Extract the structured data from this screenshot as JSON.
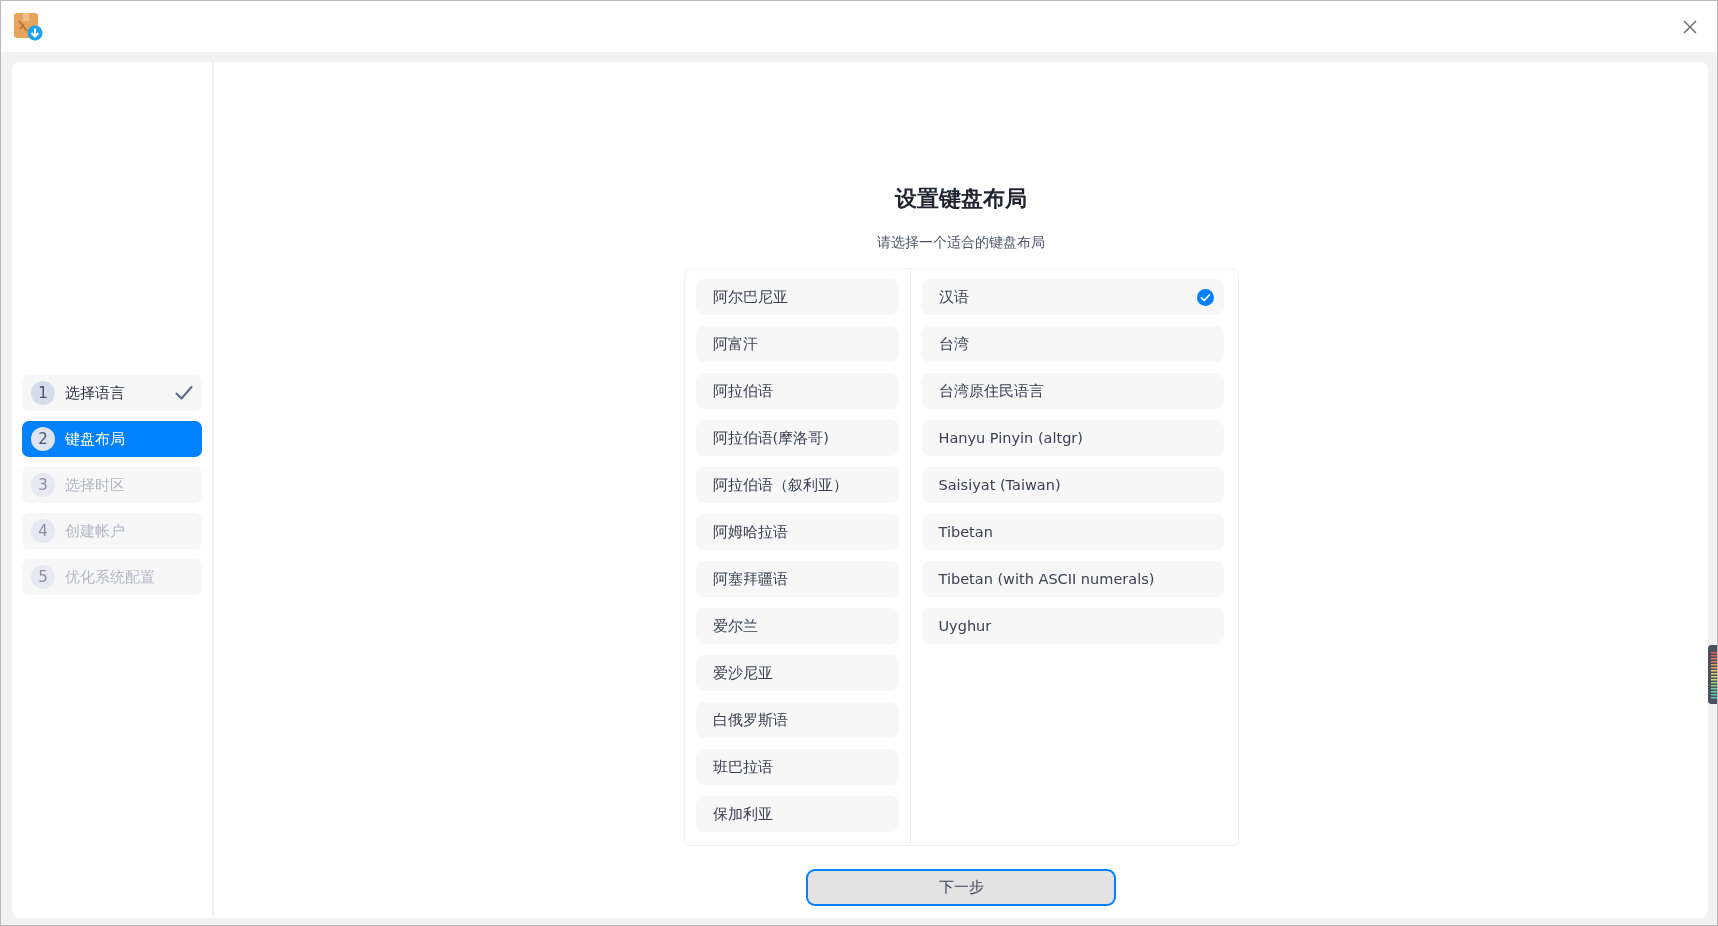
{
  "steps": [
    {
      "number": "1",
      "label": "选择语言",
      "selected": false,
      "checked": true,
      "disabled": false
    },
    {
      "number": "2",
      "label": "键盘布局",
      "selected": true,
      "checked": false,
      "disabled": false
    },
    {
      "number": "3",
      "label": "选择时区",
      "selected": false,
      "checked": false,
      "disabled": true
    },
    {
      "number": "4",
      "label": "创建帐户",
      "selected": false,
      "checked": false,
      "disabled": true
    },
    {
      "number": "5",
      "label": "优化系统配置",
      "selected": false,
      "checked": false,
      "disabled": true
    }
  ],
  "heading": "设置键盘布局",
  "subtitle": "请选择一个适合的键盘布局",
  "layouts": [
    {
      "label": "阿尔巴尼亚",
      "selected": false
    },
    {
      "label": "阿富汗",
      "selected": false
    },
    {
      "label": "阿拉伯语",
      "selected": false
    },
    {
      "label": "阿拉伯语(摩洛哥)",
      "selected": false
    },
    {
      "label": "阿拉伯语（叙利亚）",
      "selected": false
    },
    {
      "label": "阿姆哈拉语",
      "selected": false
    },
    {
      "label": "阿塞拜疆语",
      "selected": false
    },
    {
      "label": "爱尔兰",
      "selected": false
    },
    {
      "label": "爱沙尼亚",
      "selected": false
    },
    {
      "label": "白俄罗斯语",
      "selected": false
    },
    {
      "label": "班巴拉语",
      "selected": false
    },
    {
      "label": "保加利亚",
      "selected": false
    }
  ],
  "variants": [
    {
      "label": "汉语",
      "selected": true
    },
    {
      "label": "台湾",
      "selected": false
    },
    {
      "label": "台湾原住民语言",
      "selected": false
    },
    {
      "label": "Hanyu Pinyin (altgr)",
      "selected": false
    },
    {
      "label": "Saisiyat (Taiwan)",
      "selected": false
    },
    {
      "label": "Tibetan",
      "selected": false
    },
    {
      "label": "Tibetan (with ASCII numerals)",
      "selected": false
    },
    {
      "label": "Uyghur",
      "selected": false
    }
  ],
  "next_button": "下一步"
}
